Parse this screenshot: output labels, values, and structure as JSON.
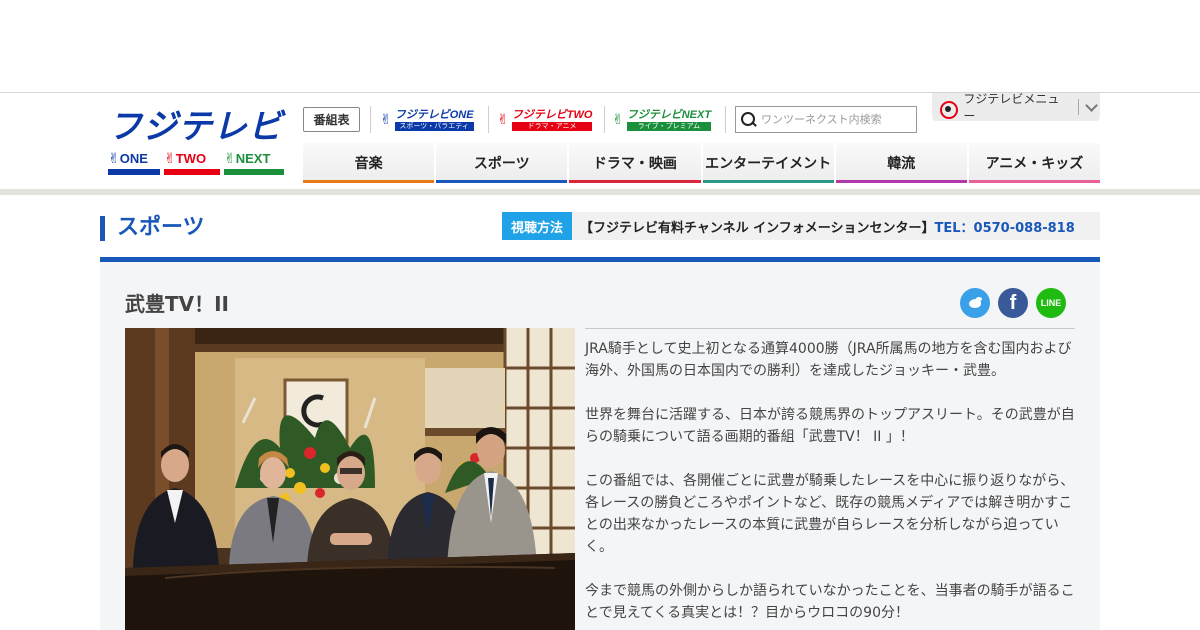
{
  "header": {
    "logo": {
      "main_text": "フジテレビ",
      "sub_one": "ONE",
      "sub_two": "TWO",
      "sub_next": "NEXT"
    },
    "program_guide_label": "番組表",
    "channels": [
      {
        "name": "フジテレビONE",
        "sub": "スポーツ・バラエティ",
        "color": "#0b3aa8"
      },
      {
        "name": "フジテレビTWO",
        "sub": "ドラマ・アニメ",
        "color": "#e60012"
      },
      {
        "name": "フジテレビNEXT",
        "sub": "ライブ・プレミアム",
        "color": "#1a8f3c"
      }
    ],
    "search_placeholder": "ワンツーネクスト内検索",
    "fuji_menu_label": "フジテレビメニュー",
    "nav": [
      {
        "label": "音楽",
        "color": "#e87a16"
      },
      {
        "label": "スポーツ",
        "color": "#1858b8"
      },
      {
        "label": "ドラマ・映画",
        "color": "#d9263c"
      },
      {
        "label": "エンターテイメント",
        "color": "#2a9a86"
      },
      {
        "label": "韓流",
        "color": "#b23aa8"
      },
      {
        "label": "アニメ・キッズ",
        "color": "#e8609a"
      }
    ]
  },
  "page": {
    "section_title": "スポーツ",
    "viewing_badge": "視聴方法",
    "info_text": "【フジテレビ有料チャンネル インフォメーションセンター】",
    "info_tel": "TEL：0570-088-818"
  },
  "program": {
    "title": "武豊TV！II",
    "share": {
      "line_label": "LINE",
      "facebook_label": "f"
    },
    "paragraphs": [
      "JRA騎手として史上初となる通算4000勝（JRA所属馬の地方を含む国内および海外、外国馬の日本国内での勝利）を達成したジョッキー・武豊。",
      "世界を舞台に活躍する、日本が誇る競馬界のトップアスリート。その武豊が自らの騎乗について語る画期的番組「武豊TV！ II 」！",
      "この番組では、各開催ごとに武豊が騎乗したレースを中心に振り返りながら、各レースの勝負どころやポイントなど、既存の競馬メディアでは解き明かすことの出来なかったレースの本質に武豊が自らレースを分析しながら迫っていく。",
      "今まで競馬の外側からしか語られていなかったことを、当事者の騎手が語ることで見えてくる真実とは！？目からウロコの90分！"
    ]
  }
}
